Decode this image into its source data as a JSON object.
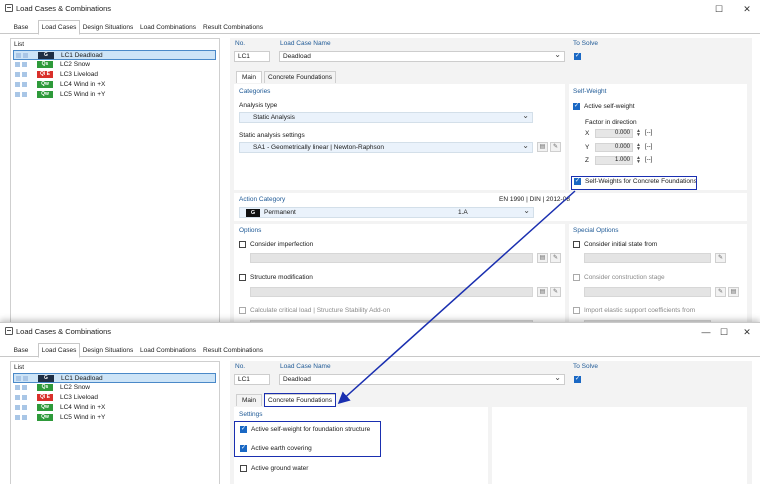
{
  "window": {
    "title": "Load Cases & Combinations"
  },
  "tabs": [
    "Base",
    "Load Cases",
    "Design Situations",
    "Load Combinations",
    "Result Combinations"
  ],
  "list": {
    "header": "List",
    "items": [
      {
        "badge": "G",
        "color": "#1e2e44",
        "name": "LC1  Deadload"
      },
      {
        "badge": "Qs",
        "color": "#2e9a3a",
        "name": "LC2  Snow"
      },
      {
        "badge": "Qi E",
        "color": "#d9302a",
        "name": "LC3  Liveload"
      },
      {
        "badge": "Qw",
        "color": "#2e9a3a",
        "name": "LC4  Wind in +X"
      },
      {
        "badge": "Qw",
        "color": "#2e9a3a",
        "name": "LC5  Wind in +Y"
      }
    ]
  },
  "header": {
    "no_label": "No.",
    "no_value": "LC1",
    "name_label": "Load Case Name",
    "name_value": "Deadload",
    "to_solve_label": "To Solve"
  },
  "inner_tabs": [
    "Main",
    "Concrete Foundations"
  ],
  "categories": {
    "title": "Categories",
    "analysis_type_label": "Analysis type",
    "analysis_type_value": "Static Analysis",
    "settings_label": "Static analysis settings",
    "settings_value": "SA1 - Geometrically linear | Newton-Raphson"
  },
  "self_weight": {
    "title": "Self-Weight",
    "active_label": "Active self-weight",
    "factor_label": "Factor in direction",
    "factors": [
      {
        "axis": "X",
        "value": "0.000",
        "unit": "[--]"
      },
      {
        "axis": "Y",
        "value": "0.000",
        "unit": "[--]"
      },
      {
        "axis": "Z",
        "value": "1.000",
        "unit": "[--]"
      }
    ],
    "concrete_label": "Self-Weights for Concrete Foundations"
  },
  "action_category": {
    "title": "Action Category",
    "standard": "EN 1990 | DIN | 2012-08",
    "badge": "G",
    "value": "Permanent",
    "code": "1.A"
  },
  "options": {
    "title": "Options",
    "items": [
      "Consider imperfection",
      "Structure modification",
      "Calculate critical load | Structure Stability Add-on"
    ]
  },
  "special_options": {
    "title": "Special Options",
    "items": [
      "Consider initial state from",
      "Consider construction stage",
      "Import elastic support coefficients from"
    ]
  },
  "concrete_tab": {
    "title": "Settings",
    "items": [
      "Active self-weight for foundation structure",
      "Active earth covering",
      "Active ground water"
    ]
  }
}
